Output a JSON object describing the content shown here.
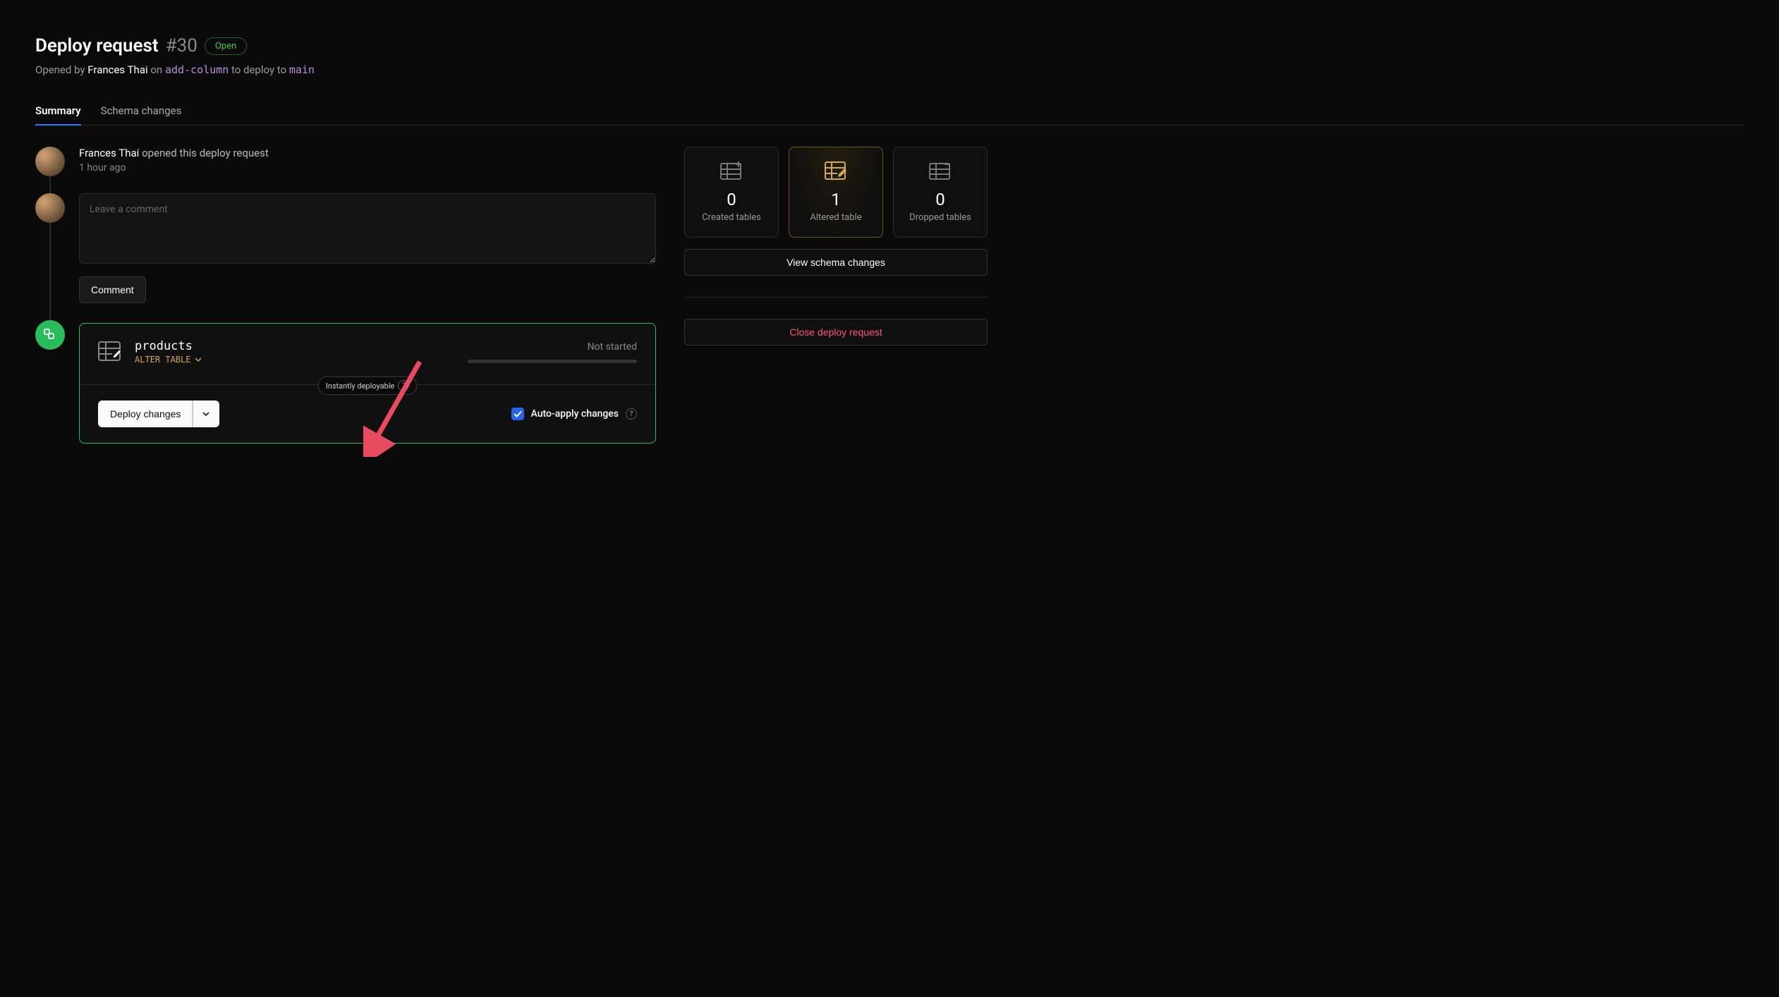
{
  "header": {
    "title": "Deploy request",
    "number": "#30",
    "status": "Open",
    "opened_by_prefix": "Opened by",
    "author": "Frances Thai",
    "on_text": "on",
    "from_branch": "add-column",
    "deploy_to_text": "to deploy to",
    "to_branch": "main"
  },
  "tabs": {
    "summary": "Summary",
    "schema": "Schema changes"
  },
  "timeline": {
    "event_author": "Frances Thai",
    "event_action": "opened this deploy request",
    "event_time": "1 hour ago",
    "comment_placeholder": "Leave a comment",
    "comment_button": "Comment"
  },
  "deploy": {
    "table_name": "products",
    "operation": "ALTER TABLE",
    "status": "Not started",
    "pill": "Instantly deployable",
    "deploy_button": "Deploy changes",
    "auto_apply": "Auto-apply changes"
  },
  "sidebar": {
    "created": {
      "value": "0",
      "label": "Created tables"
    },
    "altered": {
      "value": "1",
      "label": "Altered table"
    },
    "dropped": {
      "value": "0",
      "label": "Dropped tables"
    },
    "view_schema": "View schema changes",
    "close_request": "Close deploy request"
  }
}
